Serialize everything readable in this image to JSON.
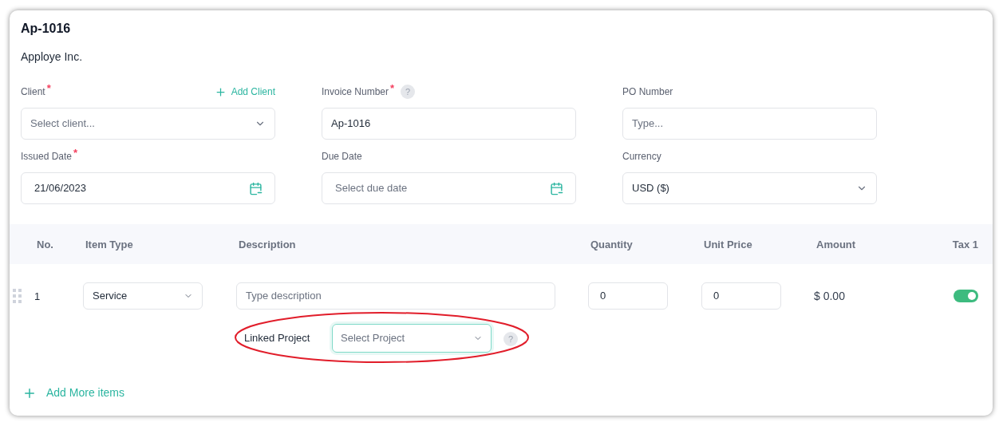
{
  "title": "Ap-1016",
  "company": "Apploye Inc.",
  "fields": [
    {
      "kind": "select",
      "label": "Client",
      "required_mark": "*",
      "action": "Add Client",
      "placeholder": "Select client..."
    },
    {
      "kind": "text",
      "label": "Invoice Number",
      "required_mark": "*",
      "help": "?",
      "value": "Ap-1016"
    },
    {
      "kind": "text",
      "label": "PO Number",
      "placeholder": "Type..."
    },
    {
      "kind": "date",
      "label": "Issued Date",
      "required_mark": "*",
      "value": "21/06/2023"
    },
    {
      "kind": "date",
      "label": "Due Date",
      "placeholder": "Select due date"
    },
    {
      "kind": "select",
      "label": "Currency",
      "value": "USD ($)"
    }
  ],
  "table": {
    "columns": [
      "No.",
      "Item Type",
      "Description",
      "Quantity",
      "Unit Price",
      "Amount",
      "Tax 1"
    ],
    "rows": [
      {
        "no": "1",
        "item_type": "Service",
        "description_placeholder": "Type description",
        "quantity": "0",
        "unit_price": "0",
        "amount": "$ 0.00",
        "tax_on": true,
        "linked_project": {
          "label": "Linked Project",
          "placeholder": "Select Project",
          "help": "?",
          "highlighted": true
        }
      }
    ]
  },
  "add_items": "Add More items"
}
